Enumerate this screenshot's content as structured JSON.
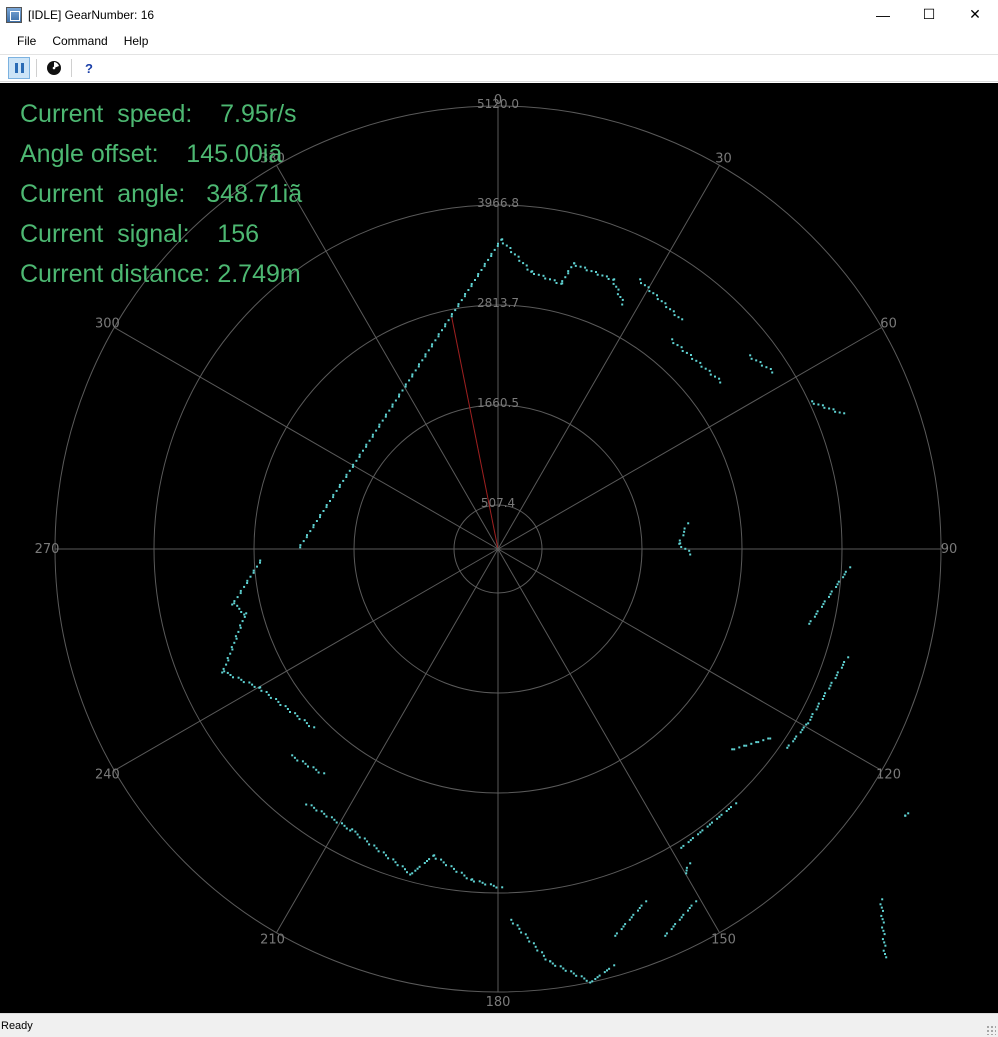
{
  "window": {
    "title": "[IDLE] GearNumber: 16",
    "controls": {
      "minimize": "—",
      "maximize": "☐",
      "close": "✕"
    }
  },
  "menu": {
    "items": [
      "File",
      "Command",
      "Help"
    ]
  },
  "toolbar": {
    "buttons": [
      {
        "icon": "pause-icon",
        "active": true
      },
      {
        "icon": "radar-icon",
        "active": false
      },
      {
        "icon": "help-icon",
        "label": "?",
        "active": false
      }
    ]
  },
  "info": {
    "speed": "Current  speed:    7.95r/s",
    "offset": "Angle offset:    145.00iã",
    "angle": "Current  angle:   348.71iã",
    "signal": "Current  signal:    156",
    "distance": "Current distance: 2.749m"
  },
  "colors": {
    "background": "#000000",
    "grid": "#5a5a5a",
    "points": "#5fd3d3",
    "text": "#4db872",
    "scan_line": "#a02020"
  },
  "radar": {
    "ring_labels": [
      "507.4",
      "1660.5",
      "2813.7",
      "3966.8",
      "5120.0"
    ],
    "ring_values": [
      507.4,
      1660.5,
      2813.7,
      3966.8,
      5120.0
    ],
    "max_range": 5120.0,
    "angle_labels": [
      "0",
      "30",
      "60",
      "90",
      "120",
      "150",
      "180",
      "210",
      "240",
      "270",
      "300",
      "330"
    ],
    "scan_angle_deg": 348.71,
    "scan_distance_mm": 2749
  },
  "status": {
    "text": "Ready"
  }
}
